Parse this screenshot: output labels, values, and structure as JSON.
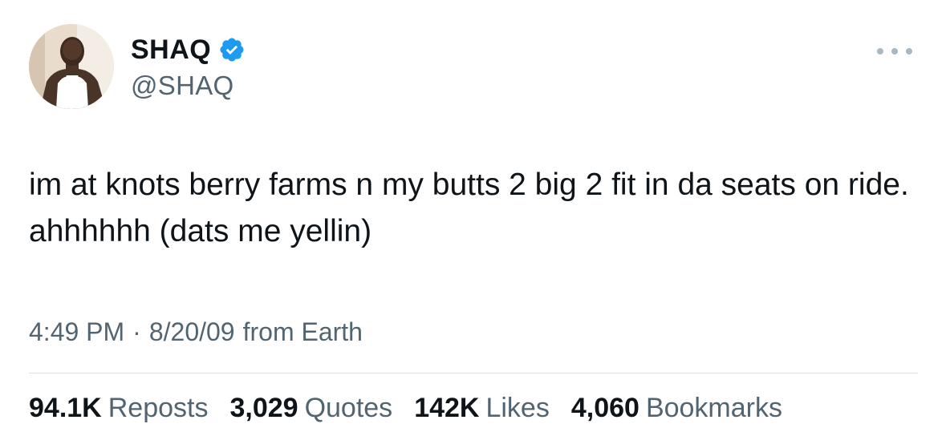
{
  "author": {
    "display_name": "SHAQ",
    "handle": "@SHAQ"
  },
  "tweet": {
    "text": "im at knots berry farms n my butts 2 big 2 fit in da seats on ride. ahhhhhh (dats me yellin)",
    "time": "4:49 PM",
    "separator": "·",
    "date": "8/20/09",
    "source": "from Earth"
  },
  "stats": {
    "reposts_count": "94.1K",
    "reposts_label": "Reposts",
    "quotes_count": "3,029",
    "quotes_label": "Quotes",
    "likes_count": "142K",
    "likes_label": "Likes",
    "bookmarks_count": "4,060",
    "bookmarks_label": "Bookmarks"
  },
  "icons": {
    "verified": "verified-badge-icon",
    "more": "more-options-icon"
  },
  "colors": {
    "verified_blue": "#1d9bf0",
    "text_primary": "#0f1419",
    "text_secondary": "#536471"
  }
}
